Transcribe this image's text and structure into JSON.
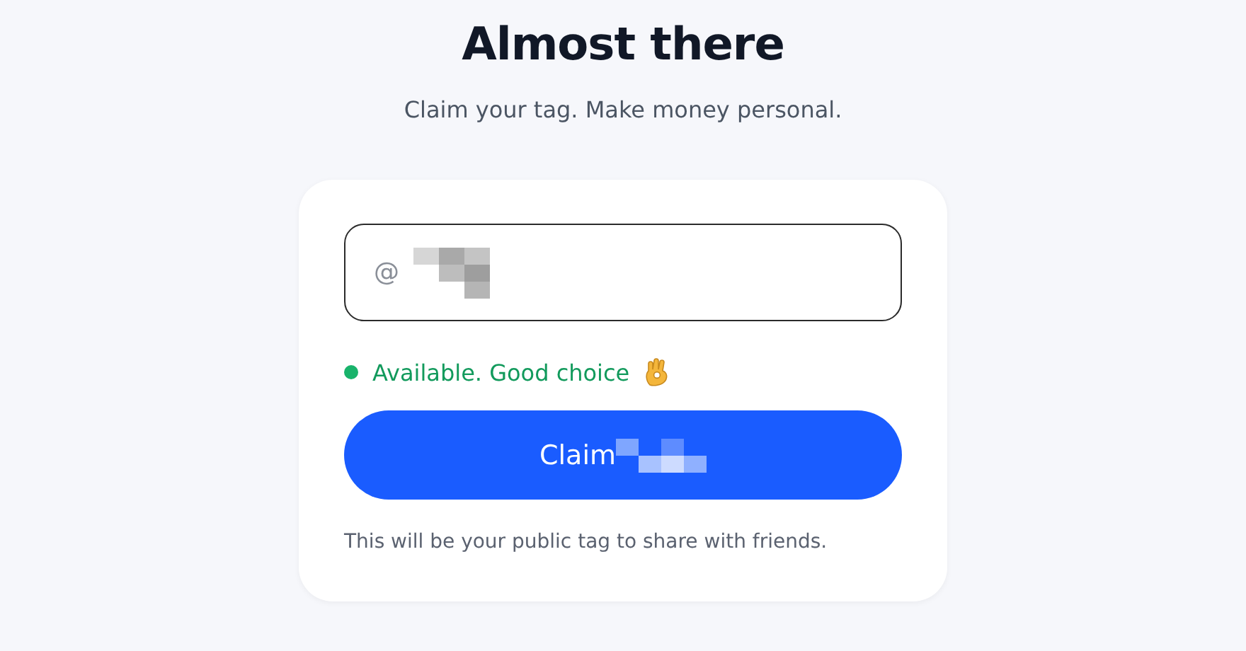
{
  "title": "Almost there",
  "subtitle": "Claim your tag. Make money personal.",
  "tag_field": {
    "prefix": "@",
    "value_hidden": true
  },
  "status": {
    "text": "Available. Good choice",
    "available": true
  },
  "claim_button": {
    "label": "Claim",
    "tag_hidden": true
  },
  "note": "This will be your public tag to share with friends."
}
